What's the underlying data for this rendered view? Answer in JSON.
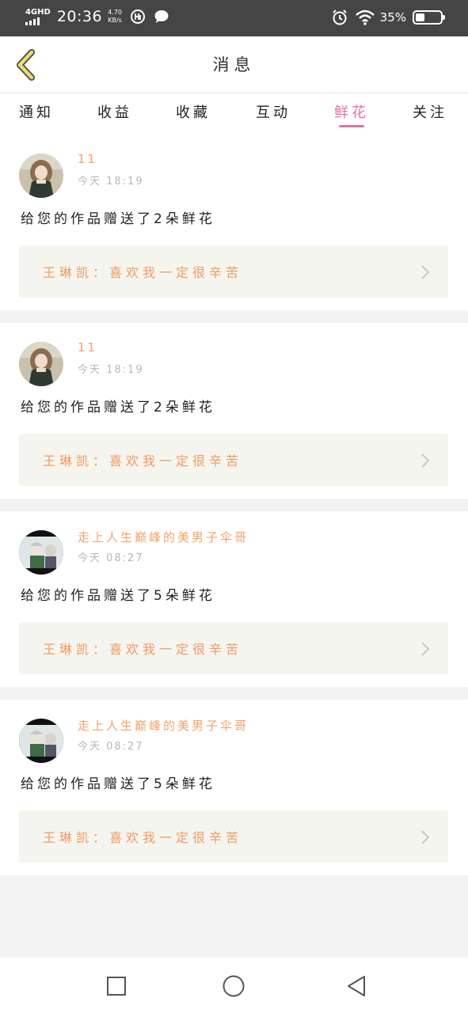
{
  "status_bar": {
    "network": "4GHD",
    "time": "20:36",
    "speed_value": "4.70",
    "speed_unit": "KB/s",
    "battery_text": "35%",
    "battery_level": 0.35,
    "icons": [
      "signal-icon",
      "hd-app-icon",
      "chat-bubble-icon",
      "alarm-icon",
      "wifi-icon",
      "battery-icon"
    ]
  },
  "header": {
    "back_icon": "chevron-left-icon",
    "title": "消息"
  },
  "tabs": [
    {
      "label": "通知",
      "active": false
    },
    {
      "label": "收益",
      "active": false
    },
    {
      "label": "收藏",
      "active": false
    },
    {
      "label": "互动",
      "active": false
    },
    {
      "label": "鲜花",
      "active": true
    },
    {
      "label": "关注",
      "active": false
    }
  ],
  "messages": [
    {
      "username": "11",
      "time": "今天 18:19",
      "action": "给您的作品赠送了2朵鲜花",
      "reply": "王琳凯：喜欢我一定很辛苦",
      "avatar": "girl-avatar"
    },
    {
      "username": "11",
      "time": "今天 18:19",
      "action": "给您的作品赠送了2朵鲜花",
      "reply": "王琳凯：喜欢我一定很辛苦",
      "avatar": "girl-avatar"
    },
    {
      "username": "走上人生巅峰的美男子伞哥",
      "time": "今天 08:27",
      "action": "给您的作品赠送了5朵鲜花",
      "reply": "王琳凯：喜欢我一定很辛苦",
      "avatar": "man-avatar"
    },
    {
      "username": "走上人生巅峰的美男子伞哥",
      "time": "今天 08:27",
      "action": "给您的作品赠送了5朵鲜花",
      "reply": "王琳凯：喜欢我一定很辛苦",
      "avatar": "man-avatar"
    }
  ],
  "bottom_nav": [
    "recent-apps-icon",
    "home-icon",
    "back-icon"
  ],
  "colors": {
    "accent": "#e46fa8",
    "username": "#f3a26a",
    "reply_text": "#f09a62",
    "reply_bg": "#f5f5ef",
    "back_chevron": "#e8dc7a"
  }
}
